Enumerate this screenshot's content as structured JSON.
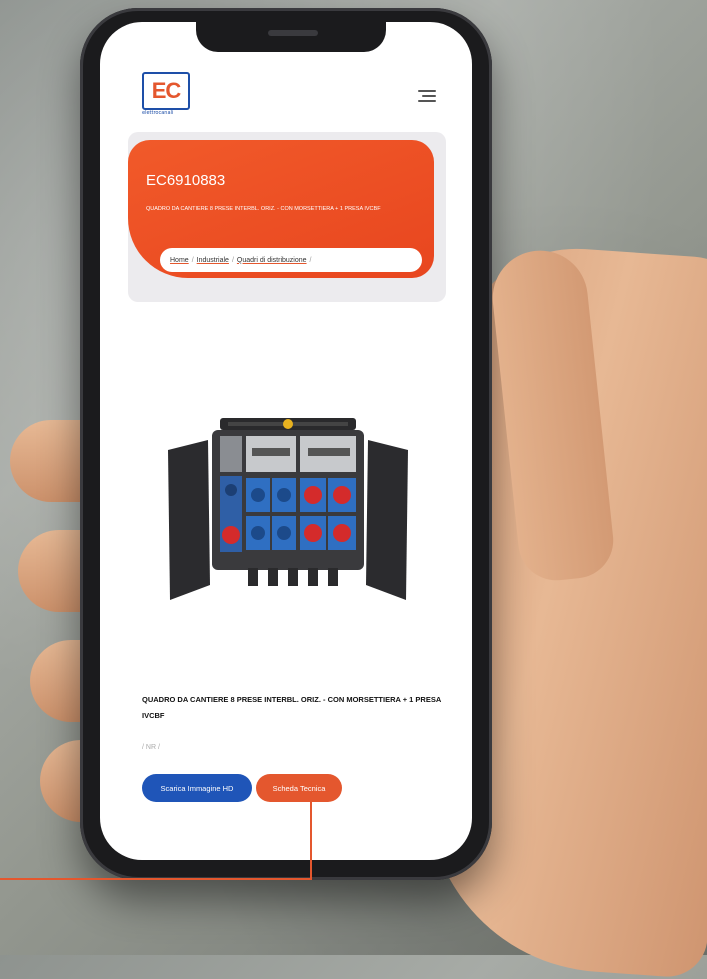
{
  "header": {
    "logo_text": "EC",
    "logo_subtext": "elettrocanali",
    "menu_icon": "hamburger-menu-icon"
  },
  "hero": {
    "code": "EC6910883",
    "description": "QUADRO DA CANTIERE 8 PRESE INTERBL. ORIZ. - CON MORSETTIERA + 1 PRESA IVCBF",
    "breadcrumb": [
      "Home",
      "Industriale",
      "Quadri di distribuzione"
    ],
    "accent_color": "#e8461f"
  },
  "product": {
    "title": "QUADRO DA CANTIERE 8 PRESE INTERBL. ORIZ. - CON MORSETTIERA + 1 PRESA IVCBF",
    "nr": "/ NR /"
  },
  "buttons": {
    "download_label": "Scarica Immagine HD",
    "datasheet_label": "Scheda Tecnica"
  },
  "colors": {
    "brand_blue": "#1f55b8",
    "brand_orange": "#e4572e"
  }
}
